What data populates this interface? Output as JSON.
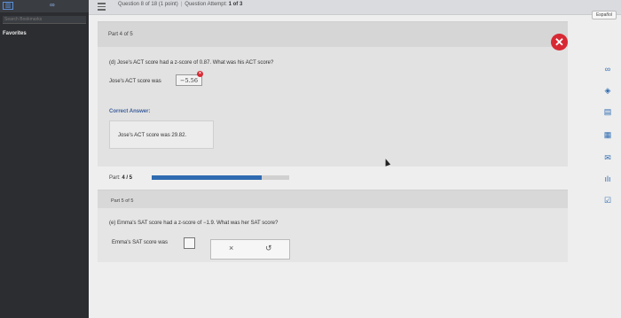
{
  "sidebar": {
    "top_button": "▥",
    "top_button2": "∞",
    "search_placeholder": "Search Bookmarks",
    "favorites_label": "Favorites"
  },
  "header": {
    "question_text": "Question 8 of 18 (1 point)",
    "attempt_text_prefix": "Question Attempt: ",
    "attempt_value": "1 of 3"
  },
  "part4": {
    "label": "Part 4 of 5",
    "question": "(d) Jose's ACT score had a z-score of 0.87. What was his ACT score?",
    "answer_label": "Jose's ACT score was",
    "answer_value": "−5.56",
    "correct_label": "Correct Answer:",
    "correct_text": "Jose's ACT score was 29.82."
  },
  "progress": {
    "label_prefix": "Part: ",
    "label_value": "4 / 5",
    "fraction": 0.8
  },
  "part5": {
    "label": "Part 5 of 5",
    "question": "(e) Emma's SAT score had a z-score of −1.9. What was her SAT score?",
    "answer_label": "Emma's SAT score was",
    "tool_clear": "×",
    "tool_undo": "↺"
  },
  "right_toolbar": {
    "language_button": "Español",
    "icons": [
      "∞",
      "◈",
      "▤",
      "▦",
      "✉",
      "ılı",
      "☑"
    ]
  },
  "colors": {
    "close_red": "#d72934",
    "progress_blue": "#2f6bb1",
    "correct_label_blue": "#3b5d9a"
  }
}
